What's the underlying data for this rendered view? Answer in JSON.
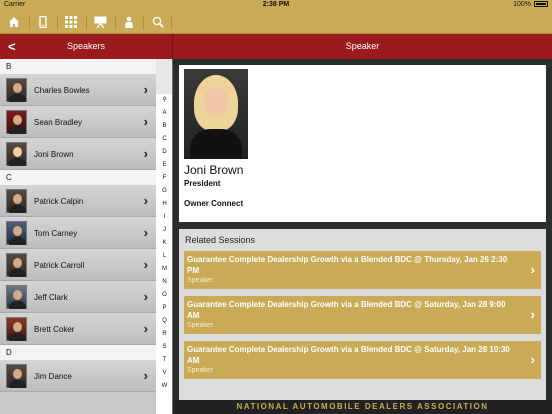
{
  "status": {
    "carrier": "Carrier",
    "time": "2:38 PM",
    "battery": "100%"
  },
  "toolbar": {
    "icons": [
      "home-icon",
      "phone-icon",
      "grid-icon",
      "presentation-icon",
      "speaker-icon",
      "search-icon"
    ]
  },
  "header": {
    "back": "<",
    "left_title": "Speakers",
    "right_title": "Speaker"
  },
  "sections": [
    {
      "letter": "B",
      "rows": [
        "Charles Bowles",
        "Sean Bradley",
        "Joni Brown"
      ]
    },
    {
      "letter": "C",
      "rows": [
        "Patrick Calpin",
        "Tom Carney",
        "Patrick Carroll",
        "Jeff Clark",
        "Brett Coker"
      ]
    },
    {
      "letter": "D",
      "rows": [
        "Jim Dance"
      ]
    }
  ],
  "index": [
    "Q",
    "A",
    "B",
    "C",
    "D",
    "E",
    "F",
    "G",
    "H",
    "I",
    "J",
    "K",
    "L",
    "M",
    "N",
    "O",
    "P",
    "Q",
    "R",
    "S",
    "T",
    "V",
    "W"
  ],
  "speaker": {
    "name": "Joni Brown",
    "title": "President",
    "company": "Owner Connect"
  },
  "related": {
    "title": "Related Sessions",
    "sessions": [
      {
        "text": "Guarantee Complete Dealership Growth via a Blended BDC @ Thursday, Jan 26 2:30 PM",
        "role": "Speaker"
      },
      {
        "text": "Guarantee Complete Dealership Growth via a Blended BDC @ Saturday, Jan 28 9:00 AM",
        "role": "Speaker"
      },
      {
        "text": "Guarantee Complete Dealership Growth via a Blended BDC @ Saturday, Jan 28 10:30 AM",
        "role": "Speaker"
      }
    ]
  },
  "footer": "NATIONAL AUTOMOBILE DEALERS ASSOCIATION",
  "colors": {
    "gold": "#c9aa56",
    "red": "#9b1a1d"
  }
}
